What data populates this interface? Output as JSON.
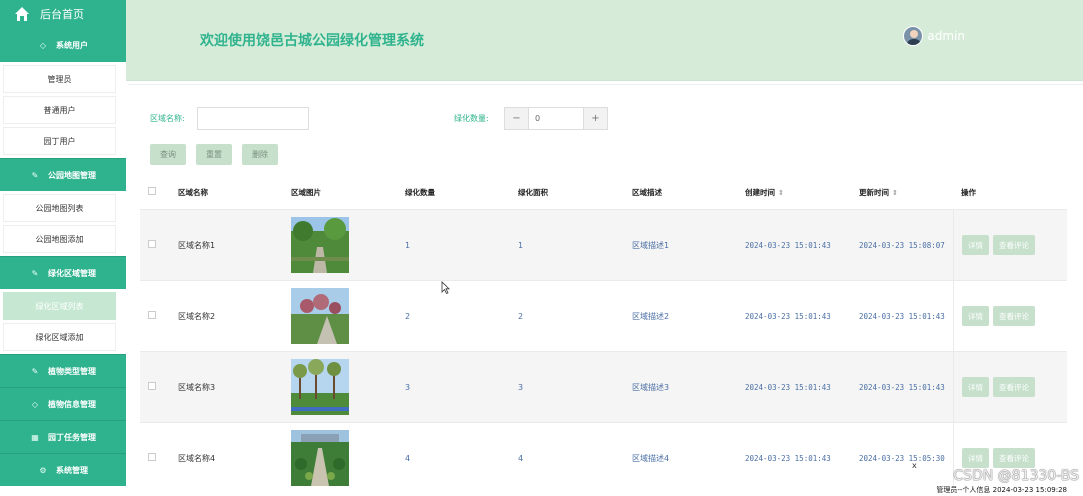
{
  "sidebar": {
    "home_label": "后台首页",
    "groups": [
      {
        "label": "系统用户",
        "icon": "diamond-icon"
      },
      {
        "label": "公园地图管理",
        "icon": "edit-icon"
      },
      {
        "label": "绿化区域管理",
        "icon": "edit-icon"
      },
      {
        "label": "植物类型管理",
        "icon": "edit-icon"
      },
      {
        "label": "植物信息管理",
        "icon": "diamond-icon"
      },
      {
        "label": "园丁任务管理",
        "icon": "calendar-icon"
      },
      {
        "label": "系统管理",
        "icon": "gear-icon"
      }
    ],
    "users_items": [
      "管理员",
      "普通用户",
      "园丁用户"
    ],
    "map_items": [
      "公园地图列表",
      "公园地图添加"
    ],
    "area_items": [
      "绿化区域列表",
      "绿化区域添加"
    ],
    "active_item": "绿化区域列表"
  },
  "header": {
    "title": "欢迎使用饶邑古城公园绿化管理系统",
    "username": "admin"
  },
  "search": {
    "area_name_label": "区域名称:",
    "area_name_value": "",
    "count_label": "绿化数量:",
    "count_value": "0",
    "minus": "−",
    "plus": "+",
    "query_button": "查询",
    "reset_button": "重置",
    "delete_button": "删除"
  },
  "table": {
    "headers": {
      "name": "区域名称",
      "image": "区域图片",
      "count": "绿化数量",
      "area": "绿化面积",
      "desc": "区域描述",
      "created": "创建时间",
      "updated": "更新时间",
      "ops": "操作"
    },
    "detail_label": "详情",
    "review_label": "查看评论",
    "rows": [
      {
        "name": "区域名称1",
        "count": "1",
        "area": "1",
        "desc": "区域描述1",
        "created": "2024-03-23 15:01:43",
        "updated": "2024-03-23 15:08:07"
      },
      {
        "name": "区域名称2",
        "count": "2",
        "area": "2",
        "desc": "区域描述2",
        "created": "2024-03-23 15:01:43",
        "updated": "2024-03-23 15:01:43"
      },
      {
        "name": "区域名称3",
        "count": "3",
        "area": "3",
        "desc": "区域描述3",
        "created": "2024-03-23 15:01:43",
        "updated": "2024-03-23 15:01:43"
      },
      {
        "name": "区域名称4",
        "count": "4",
        "area": "4",
        "desc": "区域描述4",
        "created": "2024-03-23 15:01:43",
        "updated": "2024-03-23 15:05:30"
      }
    ]
  },
  "overlay": {
    "watermark": "CSDN @81330-BS",
    "status": "管理员--个人信息 2024-03-23 15:09:28",
    "close": "x"
  },
  "colors": {
    "accent": "#2fb38e",
    "header_bg": "#d6ecd8",
    "button_bg": "#c6e0cc",
    "link_blue": "#4a6fa5"
  }
}
